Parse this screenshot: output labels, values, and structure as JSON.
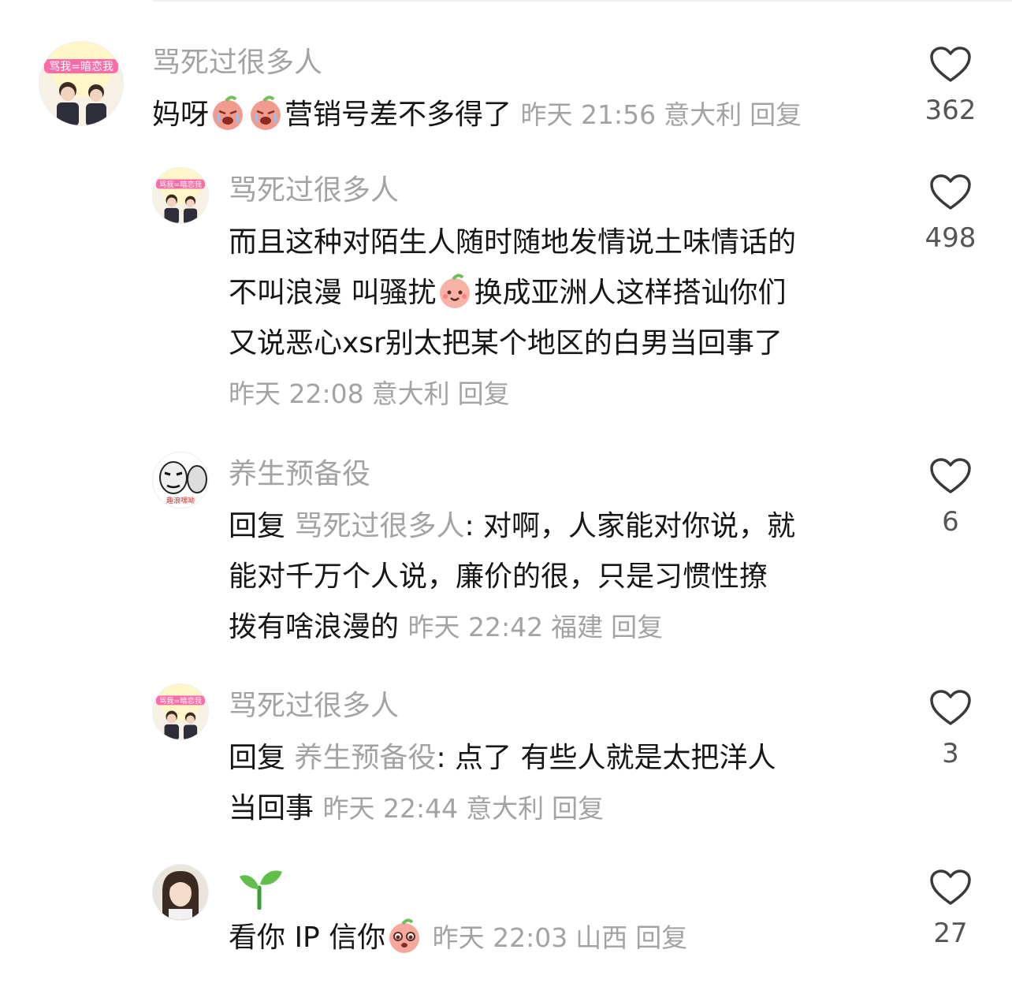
{
  "comments": [
    {
      "username": "骂死过很多人",
      "avatar_badge": "骂我=暗恋我",
      "text_a": "妈呀",
      "emoji": "crying-peach-emoji",
      "text_b": "营销号差不多得了",
      "time": "昨天 21:56",
      "location": "意大利",
      "reply": "回复",
      "likes": "362"
    },
    {
      "username": "骂死过很多人",
      "avatar_badge": "骂我=暗恋我",
      "line1": "而且这种对陌生人随时随地发情说土味情话的",
      "line2_a": "不叫浪漫 叫骚扰",
      "emoji": "smiling-peach-emoji",
      "line2_b": "换成亚洲人这样搭讪你们",
      "line3": "又说恶心xsr别太把某个地区的白男当回事了",
      "time": "昨天 22:08",
      "location": "意大利",
      "reply": "回复",
      "likes": "498"
    },
    {
      "username": "养生预备役",
      "avatar_caption": "趣浪嘿呦",
      "reply_prefix": "回复",
      "mention": "骂死过很多人",
      "line1": ": 对啊，人家能对你说，就",
      "line2": "能对千万个人说，廉价的很，只是习惯性撩",
      "line3": "拨有啥浪漫的",
      "time": "昨天 22:42",
      "location": "福建",
      "reply": "回复",
      "likes": "6"
    },
    {
      "username": "骂死过很多人",
      "avatar_badge": "骂我=暗恋我",
      "reply_prefix": "回复",
      "mention": "养生预备役",
      "line1": ": 点了 有些人就是太把洋人",
      "line2": "当回事",
      "time": "昨天 22:44",
      "location": "意大利",
      "reply": "回复",
      "likes": "3"
    },
    {
      "username_icon": "sprout-icon",
      "text_a": "看你 IP 信你",
      "emoji": "pleading-peach-emoji",
      "time": "昨天 22:03",
      "location": "山西",
      "reply": "回复",
      "likes": "27"
    }
  ],
  "colors": {
    "text": "#161616",
    "meta": "#a3a3a3",
    "heart": "#3a3a3a",
    "peach": "#f08a80"
  }
}
